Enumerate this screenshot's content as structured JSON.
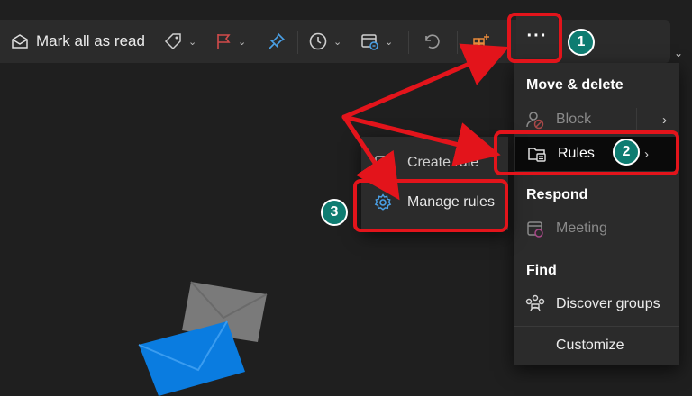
{
  "toolbar": {
    "mark_all_read_label": "Mark all as read",
    "more_label": "···"
  },
  "more_menu": {
    "move_delete_heading": "Move & delete",
    "block_label": "Block",
    "rules_label": "Rules",
    "respond_heading": "Respond",
    "meeting_label": "Meeting",
    "find_heading": "Find",
    "discover_groups_label": "Discover groups",
    "customize_label": "Customize"
  },
  "rules_submenu": {
    "create_rule_label": "Create rule",
    "manage_rules_label": "Manage rules"
  },
  "annotations": {
    "step1": "1",
    "step2": "2",
    "step3": "3",
    "highlight_color": "#e3141b",
    "badge_color": "#0e7c71"
  },
  "colors": {
    "background": "#1f1f1f",
    "toolbar": "#2b2b2b",
    "flag": "#d14b4b",
    "pin": "#4aa0e6",
    "accent_icon": "#e8893b",
    "envelope_blue": "#0a7ce0",
    "envelope_gray": "#7a7a7a"
  },
  "icons": [
    "envelope-open-icon",
    "tag-icon",
    "flag-icon",
    "pin-icon",
    "clock-icon",
    "calendar-move-icon",
    "undo-icon",
    "apps-add-icon",
    "block-icon",
    "rules-folder-icon",
    "meeting-icon",
    "discover-groups-icon",
    "create-rule-icon",
    "settings-gear-icon"
  ]
}
